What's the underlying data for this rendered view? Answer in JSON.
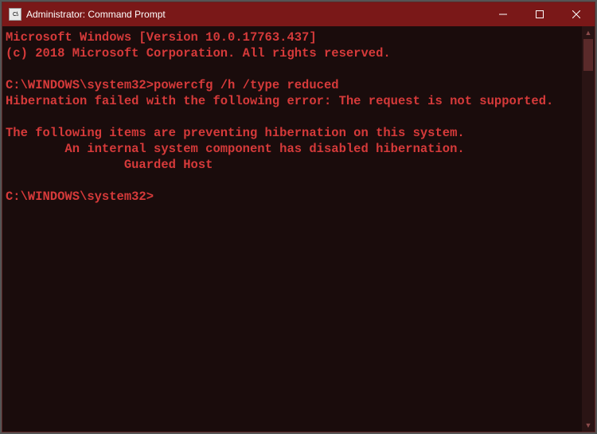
{
  "titlebar": {
    "icon_label": "C:\\",
    "title": "Administrator: Command Prompt"
  },
  "terminal": {
    "header_line1": "Microsoft Windows [Version 10.0.17763.437]",
    "header_line2": "(c) 2018 Microsoft Corporation. All rights reserved.",
    "prompt1": "C:\\WINDOWS\\system32>",
    "command1": "powercfg /h /type reduced",
    "error_line": "Hibernation failed with the following error: The request is not supported.",
    "info_line1": "The following items are preventing hibernation on this system.",
    "info_line2": "        An internal system component has disabled hibernation.",
    "info_line3": "                Guarded Host",
    "prompt2": "C:\\WINDOWS\\system32>"
  }
}
